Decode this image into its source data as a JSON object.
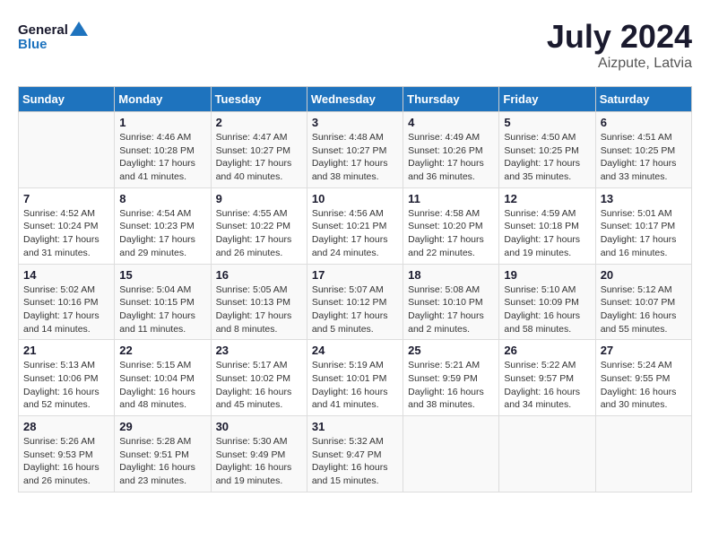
{
  "header": {
    "logo_line1": "General",
    "logo_line2": "Blue",
    "month_year": "July 2024",
    "location": "Aizpute, Latvia"
  },
  "days_of_week": [
    "Sunday",
    "Monday",
    "Tuesday",
    "Wednesday",
    "Thursday",
    "Friday",
    "Saturday"
  ],
  "weeks": [
    [
      {
        "day": "",
        "sunrise": "",
        "sunset": "",
        "daylight": ""
      },
      {
        "day": "1",
        "sunrise": "Sunrise: 4:46 AM",
        "sunset": "Sunset: 10:28 PM",
        "daylight": "Daylight: 17 hours and 41 minutes."
      },
      {
        "day": "2",
        "sunrise": "Sunrise: 4:47 AM",
        "sunset": "Sunset: 10:27 PM",
        "daylight": "Daylight: 17 hours and 40 minutes."
      },
      {
        "day": "3",
        "sunrise": "Sunrise: 4:48 AM",
        "sunset": "Sunset: 10:27 PM",
        "daylight": "Daylight: 17 hours and 38 minutes."
      },
      {
        "day": "4",
        "sunrise": "Sunrise: 4:49 AM",
        "sunset": "Sunset: 10:26 PM",
        "daylight": "Daylight: 17 hours and 36 minutes."
      },
      {
        "day": "5",
        "sunrise": "Sunrise: 4:50 AM",
        "sunset": "Sunset: 10:25 PM",
        "daylight": "Daylight: 17 hours and 35 minutes."
      },
      {
        "day": "6",
        "sunrise": "Sunrise: 4:51 AM",
        "sunset": "Sunset: 10:25 PM",
        "daylight": "Daylight: 17 hours and 33 minutes."
      }
    ],
    [
      {
        "day": "7",
        "sunrise": "Sunrise: 4:52 AM",
        "sunset": "Sunset: 10:24 PM",
        "daylight": "Daylight: 17 hours and 31 minutes."
      },
      {
        "day": "8",
        "sunrise": "Sunrise: 4:54 AM",
        "sunset": "Sunset: 10:23 PM",
        "daylight": "Daylight: 17 hours and 29 minutes."
      },
      {
        "day": "9",
        "sunrise": "Sunrise: 4:55 AM",
        "sunset": "Sunset: 10:22 PM",
        "daylight": "Daylight: 17 hours and 26 minutes."
      },
      {
        "day": "10",
        "sunrise": "Sunrise: 4:56 AM",
        "sunset": "Sunset: 10:21 PM",
        "daylight": "Daylight: 17 hours and 24 minutes."
      },
      {
        "day": "11",
        "sunrise": "Sunrise: 4:58 AM",
        "sunset": "Sunset: 10:20 PM",
        "daylight": "Daylight: 17 hours and 22 minutes."
      },
      {
        "day": "12",
        "sunrise": "Sunrise: 4:59 AM",
        "sunset": "Sunset: 10:18 PM",
        "daylight": "Daylight: 17 hours and 19 minutes."
      },
      {
        "day": "13",
        "sunrise": "Sunrise: 5:01 AM",
        "sunset": "Sunset: 10:17 PM",
        "daylight": "Daylight: 17 hours and 16 minutes."
      }
    ],
    [
      {
        "day": "14",
        "sunrise": "Sunrise: 5:02 AM",
        "sunset": "Sunset: 10:16 PM",
        "daylight": "Daylight: 17 hours and 14 minutes."
      },
      {
        "day": "15",
        "sunrise": "Sunrise: 5:04 AM",
        "sunset": "Sunset: 10:15 PM",
        "daylight": "Daylight: 17 hours and 11 minutes."
      },
      {
        "day": "16",
        "sunrise": "Sunrise: 5:05 AM",
        "sunset": "Sunset: 10:13 PM",
        "daylight": "Daylight: 17 hours and 8 minutes."
      },
      {
        "day": "17",
        "sunrise": "Sunrise: 5:07 AM",
        "sunset": "Sunset: 10:12 PM",
        "daylight": "Daylight: 17 hours and 5 minutes."
      },
      {
        "day": "18",
        "sunrise": "Sunrise: 5:08 AM",
        "sunset": "Sunset: 10:10 PM",
        "daylight": "Daylight: 17 hours and 2 minutes."
      },
      {
        "day": "19",
        "sunrise": "Sunrise: 5:10 AM",
        "sunset": "Sunset: 10:09 PM",
        "daylight": "Daylight: 16 hours and 58 minutes."
      },
      {
        "day": "20",
        "sunrise": "Sunrise: 5:12 AM",
        "sunset": "Sunset: 10:07 PM",
        "daylight": "Daylight: 16 hours and 55 minutes."
      }
    ],
    [
      {
        "day": "21",
        "sunrise": "Sunrise: 5:13 AM",
        "sunset": "Sunset: 10:06 PM",
        "daylight": "Daylight: 16 hours and 52 minutes."
      },
      {
        "day": "22",
        "sunrise": "Sunrise: 5:15 AM",
        "sunset": "Sunset: 10:04 PM",
        "daylight": "Daylight: 16 hours and 48 minutes."
      },
      {
        "day": "23",
        "sunrise": "Sunrise: 5:17 AM",
        "sunset": "Sunset: 10:02 PM",
        "daylight": "Daylight: 16 hours and 45 minutes."
      },
      {
        "day": "24",
        "sunrise": "Sunrise: 5:19 AM",
        "sunset": "Sunset: 10:01 PM",
        "daylight": "Daylight: 16 hours and 41 minutes."
      },
      {
        "day": "25",
        "sunrise": "Sunrise: 5:21 AM",
        "sunset": "Sunset: 9:59 PM",
        "daylight": "Daylight: 16 hours and 38 minutes."
      },
      {
        "day": "26",
        "sunrise": "Sunrise: 5:22 AM",
        "sunset": "Sunset: 9:57 PM",
        "daylight": "Daylight: 16 hours and 34 minutes."
      },
      {
        "day": "27",
        "sunrise": "Sunrise: 5:24 AM",
        "sunset": "Sunset: 9:55 PM",
        "daylight": "Daylight: 16 hours and 30 minutes."
      }
    ],
    [
      {
        "day": "28",
        "sunrise": "Sunrise: 5:26 AM",
        "sunset": "Sunset: 9:53 PM",
        "daylight": "Daylight: 16 hours and 26 minutes."
      },
      {
        "day": "29",
        "sunrise": "Sunrise: 5:28 AM",
        "sunset": "Sunset: 9:51 PM",
        "daylight": "Daylight: 16 hours and 23 minutes."
      },
      {
        "day": "30",
        "sunrise": "Sunrise: 5:30 AM",
        "sunset": "Sunset: 9:49 PM",
        "daylight": "Daylight: 16 hours and 19 minutes."
      },
      {
        "day": "31",
        "sunrise": "Sunrise: 5:32 AM",
        "sunset": "Sunset: 9:47 PM",
        "daylight": "Daylight: 16 hours and 15 minutes."
      },
      {
        "day": "",
        "sunrise": "",
        "sunset": "",
        "daylight": ""
      },
      {
        "day": "",
        "sunrise": "",
        "sunset": "",
        "daylight": ""
      },
      {
        "day": "",
        "sunrise": "",
        "sunset": "",
        "daylight": ""
      }
    ]
  ]
}
